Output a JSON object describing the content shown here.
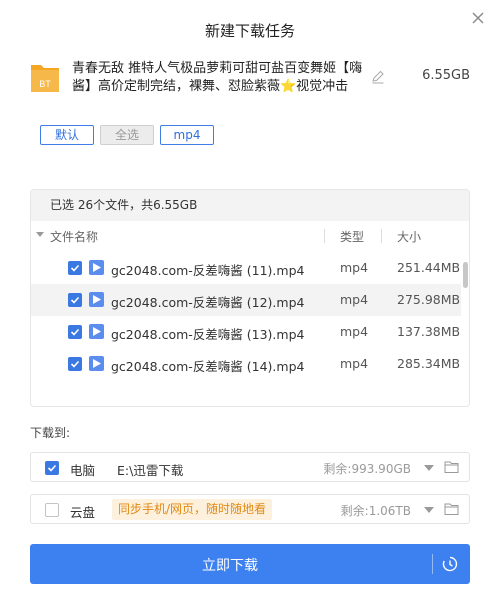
{
  "dialog": {
    "title": "新建下载任务",
    "close_icon": "close-icon"
  },
  "task": {
    "icon": "bt-torrent-icon",
    "icon_text": "BT",
    "name": "青春无敌 推特人气极品萝莉可甜可盐百变舞姬【嗨酱】高价定制完结，裸舞、怼脸紫薇⭐视觉冲击",
    "total_size": "6.55GB"
  },
  "filters": {
    "default": "默认",
    "select_all": "全选",
    "ext": "mp4"
  },
  "file_list": {
    "summary": "已选 26个文件，共6.55GB",
    "columns": {
      "name": "文件名称",
      "type": "类型",
      "size": "大小"
    },
    "rows": [
      {
        "name": "gc2048.com-反差嗨酱 (11).mp4",
        "type": "mp4",
        "size": "251.44MB",
        "checked": true
      },
      {
        "name": "gc2048.com-反差嗨酱 (12).mp4",
        "type": "mp4",
        "size": "275.98MB",
        "checked": true
      },
      {
        "name": "gc2048.com-反差嗨酱 (13).mp4",
        "type": "mp4",
        "size": "137.38MB",
        "checked": true
      },
      {
        "name": "gc2048.com-反差嗨酱 (14).mp4",
        "type": "mp4",
        "size": "285.34MB",
        "checked": true
      }
    ]
  },
  "download_to": {
    "label": "下载到:",
    "pc": {
      "label": "电脑",
      "path": "E:\\迅雷下载",
      "remaining": "剩余:993.90GB",
      "checked": true
    },
    "cloud": {
      "label": "云盘",
      "promo": "同步手机/网页，随时随地看",
      "remaining": "剩余:1.06TB",
      "checked": false
    }
  },
  "actions": {
    "download_now": "立即下载"
  },
  "colors": {
    "accent": "#3d80f0",
    "promo_bg": "#fdf1dd",
    "promo_text": "#e28a14",
    "bt_folder": "#f5a623"
  }
}
